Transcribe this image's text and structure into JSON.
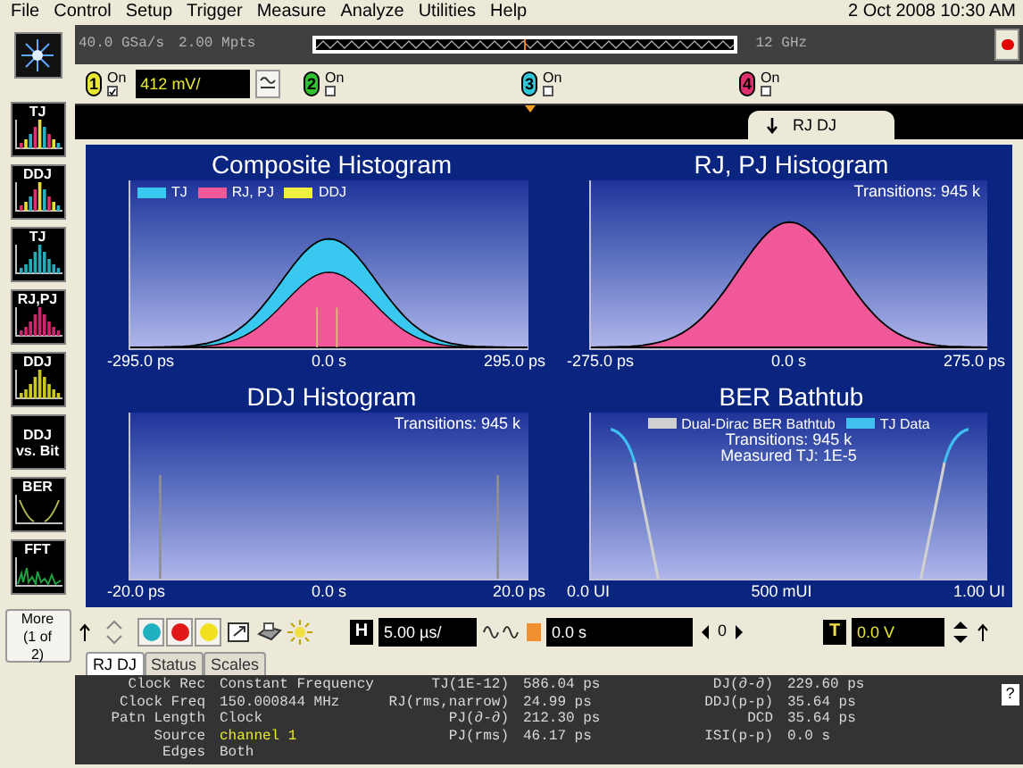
{
  "menu": [
    "File",
    "Control",
    "Setup",
    "Trigger",
    "Measure",
    "Analyze",
    "Utilities",
    "Help"
  ],
  "datetime": "2 Oct 2008 10:30 AM",
  "sidebar": [
    {
      "label": "TJ",
      "kind": "mixed-histogram"
    },
    {
      "label": "DDJ",
      "kind": "mixed-histogram"
    },
    {
      "label": "TJ",
      "kind": "histogram",
      "color": "#2aa8b8"
    },
    {
      "label": "RJ,PJ",
      "kind": "histogram",
      "color": "#c8286e"
    },
    {
      "label": "DDJ",
      "kind": "histogram",
      "color": "#c8c820"
    },
    {
      "label": "DDJ vs. Bit",
      "kind": "text"
    },
    {
      "label": "BER",
      "kind": "bathtub"
    },
    {
      "label": "FFT",
      "kind": "spectrum"
    }
  ],
  "more_button": "More (1 of 2)",
  "acquisition": {
    "sample_rate": "40.0 GSa/s",
    "memory": "2.00 Mpts",
    "bandwidth": "12 GHz"
  },
  "channels": [
    {
      "number": "1",
      "label": "On",
      "checked": true,
      "color": "#e8e830",
      "scale": "412 mV/"
    },
    {
      "number": "2",
      "label": "On",
      "checked": false,
      "color": "#30c030"
    },
    {
      "number": "3",
      "label": "On",
      "checked": false,
      "color": "#30c8d8"
    },
    {
      "number": "4",
      "label": "On",
      "checked": false,
      "color": "#e03070"
    }
  ],
  "strip_tab": "RJ DJ",
  "charts": [
    {
      "kind": "composite",
      "title": "Composite Histogram",
      "legend": [
        {
          "label": "TJ",
          "color": "#38c8f0"
        },
        {
          "label": "RJ, PJ",
          "color": "#f0589a"
        },
        {
          "label": "DDJ",
          "color": "#f0f040"
        }
      ],
      "xticks": [
        "-295.0 ps",
        "0.0 s",
        "295.0 ps"
      ]
    },
    {
      "kind": "rjpj",
      "title": "RJ, PJ Histogram",
      "notes": [
        "Transitions: 945 k"
      ],
      "xticks": [
        "-275.0 ps",
        "0.0 s",
        "275.0 ps"
      ]
    },
    {
      "kind": "ddj",
      "title": "DDJ Histogram",
      "notes": [
        "Transitions: 945 k"
      ],
      "xticks": [
        "-20.0 ps",
        "0.0 s",
        "20.0 ps"
      ]
    },
    {
      "kind": "bathtub",
      "title": "BER Bathtub",
      "legend": [
        {
          "label": "Dual-Dirac BER Bathtub",
          "color": "#d0d0d0"
        },
        {
          "label": "TJ Data",
          "color": "#40c0f0"
        }
      ],
      "notes": [
        "Transitions: 945 k",
        "Measured TJ: 1E-5"
      ],
      "xticks": [
        "0.0 UI",
        "500 mUI",
        "1.00 UI"
      ]
    }
  ],
  "color_buttons": [
    {
      "color": "#20b0c0"
    },
    {
      "color": "#e01818"
    },
    {
      "color": "#f0e020"
    }
  ],
  "controls": {
    "horizontal_button": "H",
    "time_scale": "5.00 µs/",
    "delay": "0.0 s",
    "step": "0",
    "trigger_button": "T",
    "trigger_level": "0.0 V"
  },
  "tabs": [
    {
      "label": "RJ DJ",
      "selected": true
    },
    {
      "label": "Status",
      "selected": false
    },
    {
      "label": "Scales",
      "selected": false
    }
  ],
  "results": [
    [
      {
        "label": "Clock Rec",
        "value": "Constant Frequency",
        "highlighted": false
      },
      {
        "label": "Clock Freq",
        "value": "150.000844 MHz",
        "highlighted": false
      },
      {
        "label": "Patn Length",
        "value": "Clock",
        "highlighted": false
      },
      {
        "label": "Source",
        "value": "channel 1",
        "highlighted": true
      },
      {
        "label": "Edges",
        "value": "Both",
        "highlighted": false
      }
    ],
    [
      {
        "label": "TJ(1E-12)",
        "value": "586.04 ps",
        "highlighted": false
      },
      {
        "label": "RJ(rms,narrow)",
        "value": "24.99 ps",
        "highlighted": false
      },
      {
        "label": "PJ(∂-∂)",
        "value": "212.30 ps",
        "highlighted": false
      },
      {
        "label": "PJ(rms)",
        "value": "46.17 ps",
        "highlighted": false
      }
    ],
    [
      {
        "label": "DJ(∂-∂)",
        "value": "229.60 ps",
        "highlighted": false
      },
      {
        "label": "DDJ(p-p)",
        "value": "35.64 ps",
        "highlighted": false
      },
      {
        "label": "DCD",
        "value": "35.64 ps",
        "highlighted": false
      },
      {
        "label": "ISI(p-p)",
        "value": "0.0 s",
        "highlighted": false
      }
    ]
  ],
  "help_button": "?"
}
